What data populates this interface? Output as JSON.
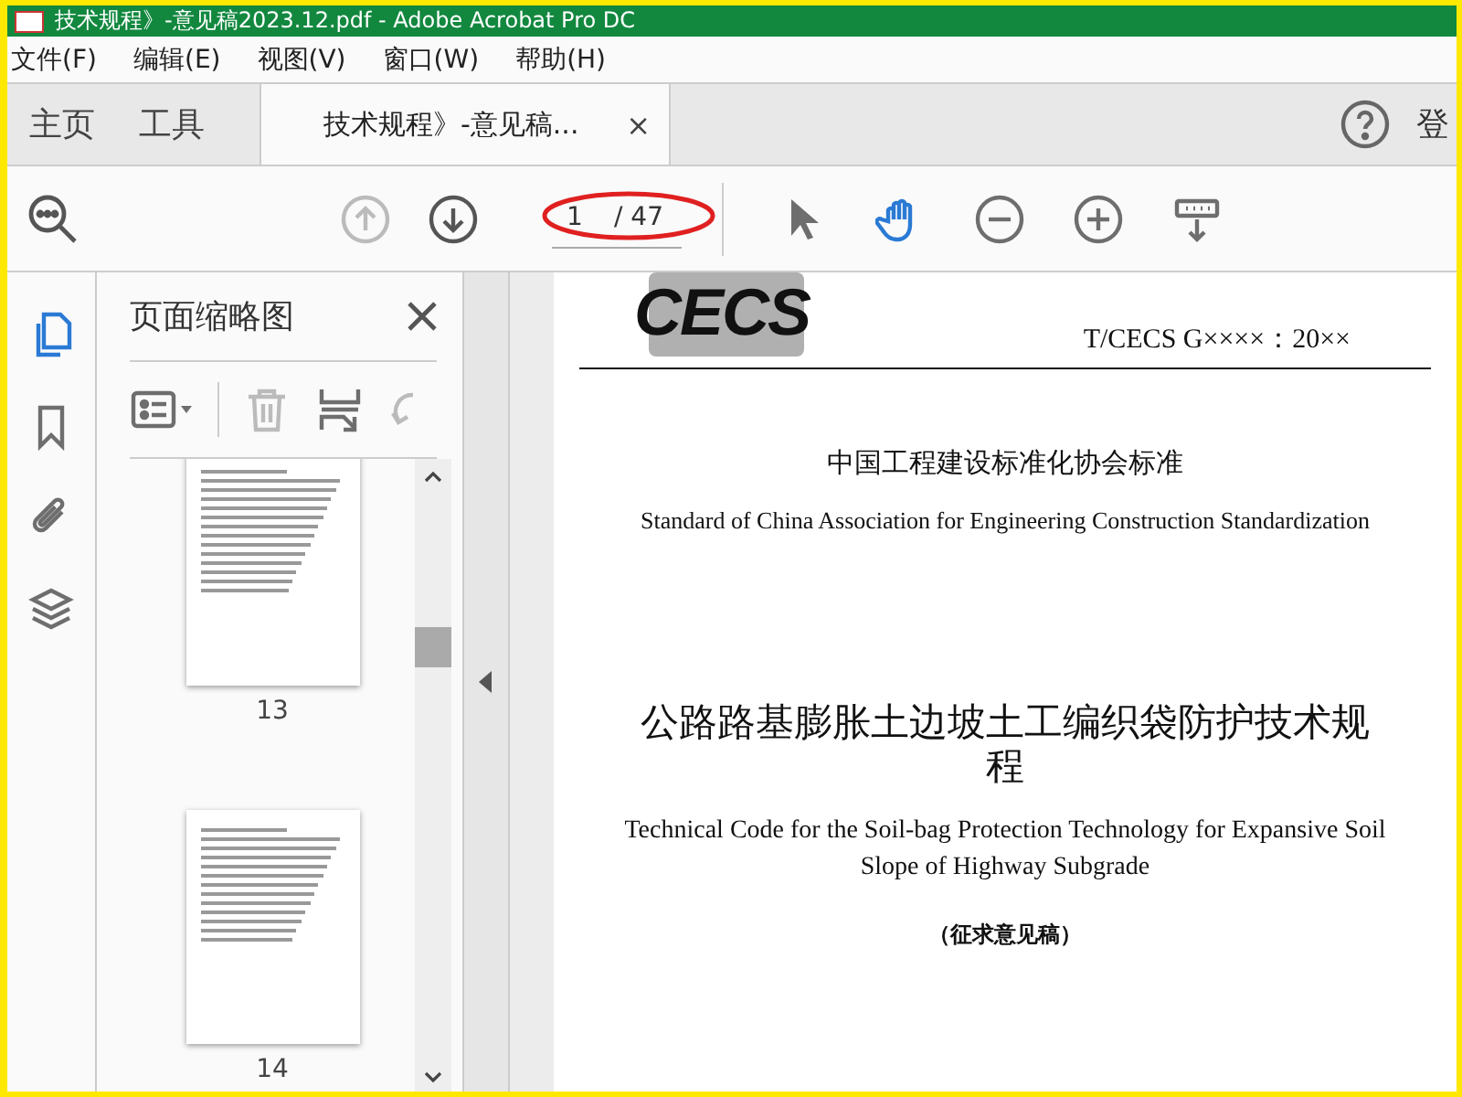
{
  "window": {
    "title": "技术规程》-意见稿2023.12.pdf - Adobe Acrobat Pro DC"
  },
  "menu": [
    "文件(F)",
    "编辑(E)",
    "视图(V)",
    "窗口(W)",
    "帮助(H)"
  ],
  "tabs": [
    {
      "label": "主页",
      "selected": false
    },
    {
      "label": "工具",
      "selected": false
    },
    {
      "label": "技术规程》-意见稿...",
      "selected": true,
      "close": "×"
    }
  ],
  "account_label": "登",
  "toolbar": {
    "nav": [
      {
        "kind": "up",
        "disabled": true
      },
      {
        "kind": "down",
        "disabled": false
      }
    ],
    "page_current": "1",
    "page_total": "/ 47",
    "tools": [
      {
        "kind": "select",
        "selected": false
      },
      {
        "kind": "hand",
        "selected": true
      },
      {
        "kind": "zoom-out",
        "selected": false
      },
      {
        "kind": "zoom-in",
        "selected": false
      },
      {
        "kind": "keyboard",
        "selected": false
      }
    ]
  },
  "rail": [
    {
      "kind": "pages",
      "selected": true
    },
    {
      "kind": "bookmark",
      "selected": false
    },
    {
      "kind": "attachment",
      "selected": false
    },
    {
      "kind": "layers",
      "selected": false
    }
  ],
  "thumbnail_panel": {
    "title": "页面缩略图",
    "tools": [
      {
        "kind": "options",
        "disabled": false
      },
      {
        "kind": "trash",
        "disabled": true
      },
      {
        "kind": "insert",
        "disabled": false
      },
      {
        "kind": "rotate",
        "disabled": true
      }
    ],
    "pages": [
      {
        "number": "13"
      },
      {
        "number": "14"
      }
    ]
  },
  "document": {
    "logo": "CECS",
    "code": "T/CECS G××××：20××",
    "org_cn": "中国工程建设标准化协会标准",
    "org_en": "Standard of China Association for Engineering Construction Standardization",
    "title_cn": "公路路基膨胀土边坡土工编织袋防护技术规程",
    "title_en": "Technical Code for the Soil-bag Protection Technology for Expansive Soil Slope of Highway Subgrade",
    "status": "（征求意见稿）"
  }
}
